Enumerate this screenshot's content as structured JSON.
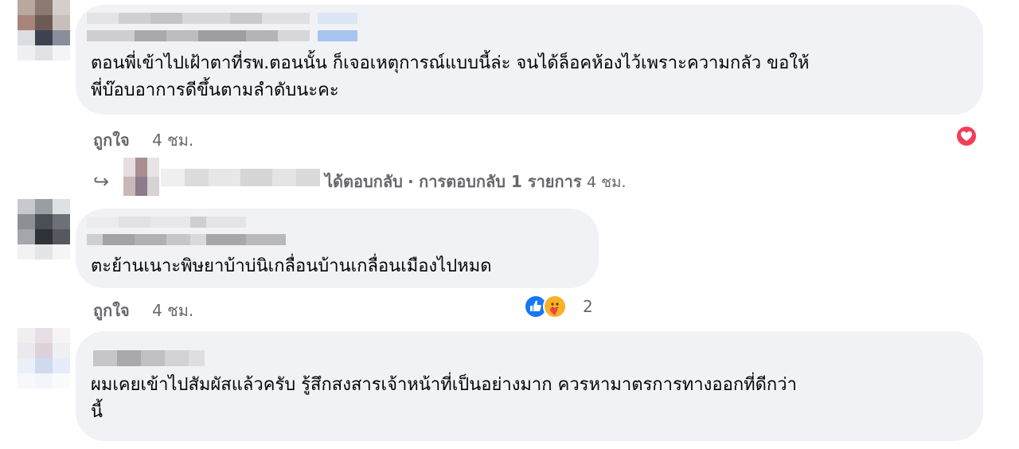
{
  "comments": [
    {
      "text_line1": "ตอนพี่เข้าไปเฝ้าตาที่รพ.ตอนนั้น ก็เจอเหตุการณ์แบบนี้ล่ะ จนได้ล็อคห้องไว้เพราะความกลัว ขอให้",
      "text_line2": "พี่บ๊อบอาการดีขึ้นตามลำดับนะคะ",
      "like_label": "ถูกใจ",
      "time": "4 ชม.",
      "reaction_icons": [
        "heart-icon"
      ],
      "reply_summary": {
        "replied_label": "ได้ตอบกลับ",
        "separator": "·",
        "replies_label": "การตอบกลับ 1 รายการ",
        "time": "4 ชม."
      }
    },
    {
      "text_line1": "ตะย้านเนาะพิษยาบ้าบ่นิเกลื่อนบ้านเกลื่อนเมืองไปหมด",
      "like_label": "ถูกใจ",
      "time": "4 ชม.",
      "reaction_icons": [
        "like-icon",
        "care-icon"
      ],
      "reaction_count": "2"
    },
    {
      "text_line1": "ผมเคยเข้าไปสัมผัสแล้วครับ รู้สึกสงสารเจ้าหน้าที่เป็นอย่างมาก ควรหามาตรการทางออกที่ดีกว่า",
      "text_line2": "นี้"
    }
  ],
  "colors": {
    "bubble": "#f0f2f5",
    "secondary_text": "#65676b",
    "heart": "#f33e58",
    "like": "#1877f2",
    "care": "#f7b125"
  }
}
